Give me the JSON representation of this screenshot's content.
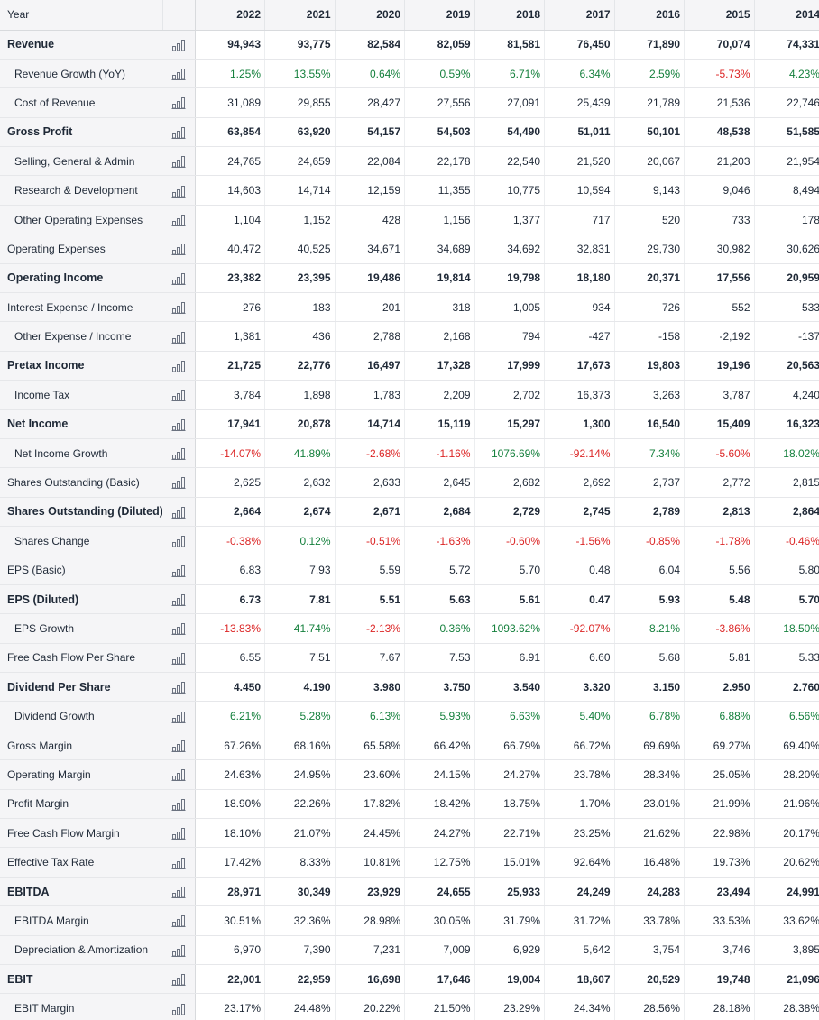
{
  "table": {
    "year_header": "Year",
    "years": [
      "2022",
      "2021",
      "2020",
      "2019",
      "2018",
      "2017",
      "2016",
      "2015",
      "2014"
    ],
    "rows": [
      {
        "label": "Revenue",
        "style": "bold",
        "values": [
          "94,943",
          "93,775",
          "82,584",
          "82,059",
          "81,581",
          "76,450",
          "71,890",
          "70,074",
          "74,331"
        ]
      },
      {
        "label": "Revenue Growth (YoY)",
        "style": "sub",
        "colored": true,
        "values": [
          "1.25%",
          "13.55%",
          "0.64%",
          "0.59%",
          "6.71%",
          "6.34%",
          "2.59%",
          "-5.73%",
          "4.23%"
        ]
      },
      {
        "label": "Cost of Revenue",
        "style": "sub",
        "values": [
          "31,089",
          "29,855",
          "28,427",
          "27,556",
          "27,091",
          "25,439",
          "21,789",
          "21,536",
          "22,746"
        ]
      },
      {
        "label": "Gross Profit",
        "style": "bold",
        "values": [
          "63,854",
          "63,920",
          "54,157",
          "54,503",
          "54,490",
          "51,011",
          "50,101",
          "48,538",
          "51,585"
        ]
      },
      {
        "label": "Selling, General & Admin",
        "style": "sub",
        "values": [
          "24,765",
          "24,659",
          "22,084",
          "22,178",
          "22,540",
          "21,520",
          "20,067",
          "21,203",
          "21,954"
        ]
      },
      {
        "label": "Research & Development",
        "style": "sub",
        "values": [
          "14,603",
          "14,714",
          "12,159",
          "11,355",
          "10,775",
          "10,594",
          "9,143",
          "9,046",
          "8,494"
        ]
      },
      {
        "label": "Other Operating Expenses",
        "style": "sub",
        "values": [
          "1,104",
          "1,152",
          "428",
          "1,156",
          "1,377",
          "717",
          "520",
          "733",
          "178"
        ]
      },
      {
        "label": "Operating Expenses",
        "style": "normal",
        "values": [
          "40,472",
          "40,525",
          "34,671",
          "34,689",
          "34,692",
          "32,831",
          "29,730",
          "30,982",
          "30,626"
        ]
      },
      {
        "label": "Operating Income",
        "style": "bold",
        "values": [
          "23,382",
          "23,395",
          "19,486",
          "19,814",
          "19,798",
          "18,180",
          "20,371",
          "17,556",
          "20,959"
        ]
      },
      {
        "label": "Interest Expense / Income",
        "style": "normal",
        "values": [
          "276",
          "183",
          "201",
          "318",
          "1,005",
          "934",
          "726",
          "552",
          "533"
        ]
      },
      {
        "label": "Other Expense / Income",
        "style": "sub",
        "values": [
          "1,381",
          "436",
          "2,788",
          "2,168",
          "794",
          "-427",
          "-158",
          "-2,192",
          "-137"
        ]
      },
      {
        "label": "Pretax Income",
        "style": "bold",
        "values": [
          "21,725",
          "22,776",
          "16,497",
          "17,328",
          "17,999",
          "17,673",
          "19,803",
          "19,196",
          "20,563"
        ]
      },
      {
        "label": "Income Tax",
        "style": "sub",
        "values": [
          "3,784",
          "1,898",
          "1,783",
          "2,209",
          "2,702",
          "16,373",
          "3,263",
          "3,787",
          "4,240"
        ]
      },
      {
        "label": "Net Income",
        "style": "bold",
        "values": [
          "17,941",
          "20,878",
          "14,714",
          "15,119",
          "15,297",
          "1,300",
          "16,540",
          "15,409",
          "16,323"
        ]
      },
      {
        "label": "Net Income Growth",
        "style": "sub",
        "colored": true,
        "values": [
          "-14.07%",
          "41.89%",
          "-2.68%",
          "-1.16%",
          "1076.69%",
          "-92.14%",
          "7.34%",
          "-5.60%",
          "18.02%"
        ]
      },
      {
        "label": "Shares Outstanding (Basic)",
        "style": "normal",
        "values": [
          "2,625",
          "2,632",
          "2,633",
          "2,645",
          "2,682",
          "2,692",
          "2,737",
          "2,772",
          "2,815"
        ]
      },
      {
        "label": "Shares Outstanding (Diluted)",
        "style": "bold",
        "values": [
          "2,664",
          "2,674",
          "2,671",
          "2,684",
          "2,729",
          "2,745",
          "2,789",
          "2,813",
          "2,864"
        ]
      },
      {
        "label": "Shares Change",
        "style": "sub",
        "colored": true,
        "values": [
          "-0.38%",
          "0.12%",
          "-0.51%",
          "-1.63%",
          "-0.60%",
          "-1.56%",
          "-0.85%",
          "-1.78%",
          "-0.46%"
        ]
      },
      {
        "label": "EPS (Basic)",
        "style": "normal",
        "values": [
          "6.83",
          "7.93",
          "5.59",
          "5.72",
          "5.70",
          "0.48",
          "6.04",
          "5.56",
          "5.80"
        ]
      },
      {
        "label": "EPS (Diluted)",
        "style": "bold",
        "values": [
          "6.73",
          "7.81",
          "5.51",
          "5.63",
          "5.61",
          "0.47",
          "5.93",
          "5.48",
          "5.70"
        ]
      },
      {
        "label": "EPS Growth",
        "style": "sub",
        "colored": true,
        "values": [
          "-13.83%",
          "41.74%",
          "-2.13%",
          "0.36%",
          "1093.62%",
          "-92.07%",
          "8.21%",
          "-3.86%",
          "18.50%"
        ]
      },
      {
        "label": "Free Cash Flow Per Share",
        "style": "normal",
        "values": [
          "6.55",
          "7.51",
          "7.67",
          "7.53",
          "6.91",
          "6.60",
          "5.68",
          "5.81",
          "5.33"
        ]
      },
      {
        "label": "Dividend Per Share",
        "style": "bold",
        "values": [
          "4.450",
          "4.190",
          "3.980",
          "3.750",
          "3.540",
          "3.320",
          "3.150",
          "2.950",
          "2.760"
        ]
      },
      {
        "label": "Dividend Growth",
        "style": "sub",
        "colored": true,
        "values": [
          "6.21%",
          "5.28%",
          "6.13%",
          "5.93%",
          "6.63%",
          "5.40%",
          "6.78%",
          "6.88%",
          "6.56%"
        ]
      },
      {
        "label": "Gross Margin",
        "style": "normal",
        "values": [
          "67.26%",
          "68.16%",
          "65.58%",
          "66.42%",
          "66.79%",
          "66.72%",
          "69.69%",
          "69.27%",
          "69.40%"
        ]
      },
      {
        "label": "Operating Margin",
        "style": "normal",
        "values": [
          "24.63%",
          "24.95%",
          "23.60%",
          "24.15%",
          "24.27%",
          "23.78%",
          "28.34%",
          "25.05%",
          "28.20%"
        ]
      },
      {
        "label": "Profit Margin",
        "style": "normal",
        "values": [
          "18.90%",
          "22.26%",
          "17.82%",
          "18.42%",
          "18.75%",
          "1.70%",
          "23.01%",
          "21.99%",
          "21.96%"
        ]
      },
      {
        "label": "Free Cash Flow Margin",
        "style": "normal",
        "values": [
          "18.10%",
          "21.07%",
          "24.45%",
          "24.27%",
          "22.71%",
          "23.25%",
          "21.62%",
          "22.98%",
          "20.17%"
        ]
      },
      {
        "label": "Effective Tax Rate",
        "style": "normal",
        "values": [
          "17.42%",
          "8.33%",
          "10.81%",
          "12.75%",
          "15.01%",
          "92.64%",
          "16.48%",
          "19.73%",
          "20.62%"
        ]
      },
      {
        "label": "EBITDA",
        "style": "bold",
        "values": [
          "28,971",
          "30,349",
          "23,929",
          "24,655",
          "25,933",
          "24,249",
          "24,283",
          "23,494",
          "24,991"
        ]
      },
      {
        "label": "EBITDA Margin",
        "style": "sub",
        "values": [
          "30.51%",
          "32.36%",
          "28.98%",
          "30.05%",
          "31.79%",
          "31.72%",
          "33.78%",
          "33.53%",
          "33.62%"
        ]
      },
      {
        "label": "Depreciation & Amortization",
        "style": "sub",
        "values": [
          "6,970",
          "7,390",
          "7,231",
          "7,009",
          "6,929",
          "5,642",
          "3,754",
          "3,746",
          "3,895"
        ]
      },
      {
        "label": "EBIT",
        "style": "bold",
        "values": [
          "22,001",
          "22,959",
          "16,698",
          "17,646",
          "19,004",
          "18,607",
          "20,529",
          "19,748",
          "21,096"
        ]
      },
      {
        "label": "EBIT Margin",
        "style": "sub",
        "values": [
          "23.17%",
          "24.48%",
          "20.22%",
          "21.50%",
          "23.29%",
          "24.34%",
          "28.56%",
          "28.18%",
          "28.38%"
        ]
      }
    ]
  },
  "icons": {
    "chart": "bar-chart-icon"
  },
  "colors": {
    "positive": "#15803d",
    "negative": "#dc2626",
    "label_bg": "#f5f5f7",
    "icon_stroke": "#6b7280"
  }
}
